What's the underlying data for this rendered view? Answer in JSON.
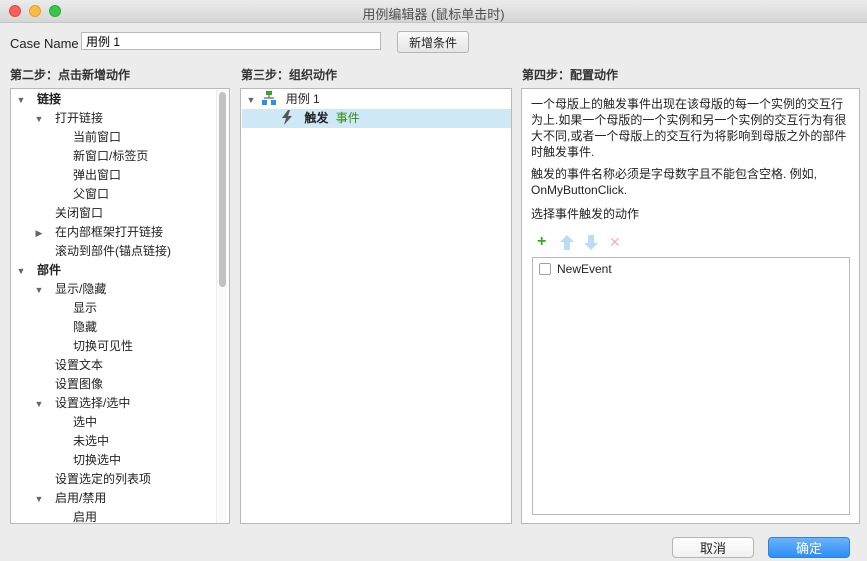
{
  "window": {
    "title": "用例编辑器 (鼠标单击时)"
  },
  "case": {
    "label": "Case Name",
    "value": "用例 1",
    "add_condition_label": "新增条件"
  },
  "step2": {
    "title": "第二步：点击新增动作",
    "rows": [
      {
        "label": "链接",
        "toggle": "▼",
        "bold": true
      },
      {
        "label": "打开链接",
        "toggle": "▼"
      },
      {
        "label": "当前窗口"
      },
      {
        "label": "新窗口/标签页"
      },
      {
        "label": "弹出窗口"
      },
      {
        "label": "父窗口"
      },
      {
        "label": "关闭窗口"
      },
      {
        "label": "在内部框架打开链接",
        "toggle": "▶"
      },
      {
        "label": "滚动到部件(锚点链接)"
      },
      {
        "label": "部件",
        "toggle": "▼",
        "bold": true
      },
      {
        "label": "显示/隐藏",
        "toggle": "▼"
      },
      {
        "label": "显示"
      },
      {
        "label": "隐藏"
      },
      {
        "label": "切换可见性"
      },
      {
        "label": "设置文本"
      },
      {
        "label": "设置图像"
      },
      {
        "label": "设置选择/选中",
        "toggle": "▼"
      },
      {
        "label": "选中"
      },
      {
        "label": "未选中"
      },
      {
        "label": "切换选中"
      },
      {
        "label": "设置选定的列表项"
      },
      {
        "label": "启用/禁用",
        "toggle": "▼"
      },
      {
        "label": "启用"
      }
    ]
  },
  "step3": {
    "title": "第三步：组织动作",
    "case_label": "用例 1",
    "case_toggle": "▼",
    "event_prefix": "触发",
    "event_label": "事件"
  },
  "step4": {
    "title": "第四步：配置动作",
    "description": "一个母版上的触发事件出现在该母版的每一个实例的交互行为上.如果一个母版的一个实例和另一个实例的交互行为有很大不同,或者一个母版上的交互行为将影响到母版之外的部件时触发事件.",
    "note": "触发的事件名称必须是字母数字且不能包含空格. 例如, OnMyButtonClick.",
    "choose_label": "选择事件触发的动作",
    "icons": {
      "add": "+",
      "up": "arrow-up",
      "down": "arrow-down",
      "delete": "✕"
    },
    "items": [
      {
        "label": "NewEvent",
        "checked": false
      }
    ]
  },
  "footer": {
    "cancel_label": "取消",
    "ok_label": "确定"
  },
  "colors": {
    "accent": "#2b8ef3",
    "selection": "#cfe8f5",
    "add_icon": "#3aa528",
    "event_text": "#3a8c1a"
  }
}
